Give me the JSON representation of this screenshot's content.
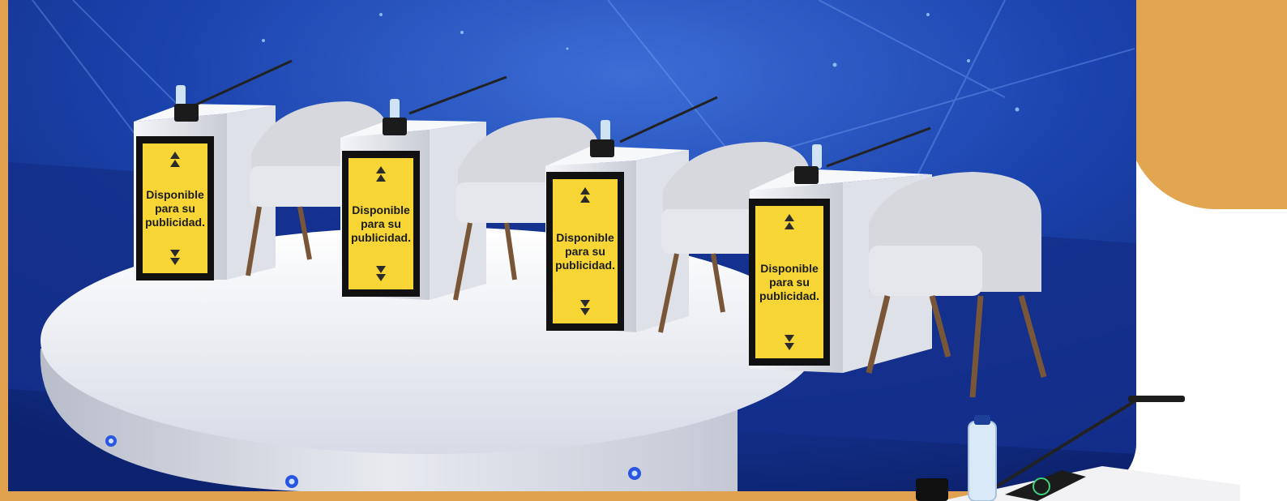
{
  "image": {
    "description_colors": {
      "frame": "#e0a24e",
      "background_blue": "#1c3fa8",
      "stage": "#eef0f6",
      "sign_yellow": "#f6d534",
      "sign_border": "#111111",
      "chair": "#d9dbe0",
      "leg": "#7a5638"
    }
  },
  "signs": [
    {
      "line1": "Disponible",
      "line2": "para su",
      "line3": "publicidad."
    },
    {
      "line1": "Disponible",
      "line2": "para su",
      "line3": "publicidad."
    },
    {
      "line1": "Disponible",
      "line2": "para su",
      "line3": "publicidad."
    },
    {
      "line1": "Disponible",
      "line2": "para su",
      "line3": "publicidad."
    }
  ]
}
